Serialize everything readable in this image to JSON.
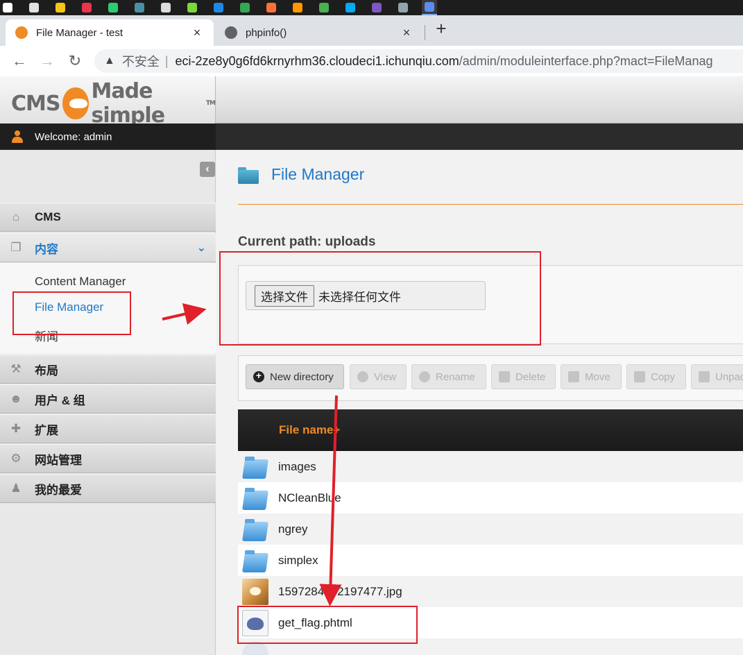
{
  "taskbar": {
    "icons": [
      {
        "name": "windows-start-icon",
        "color": "#ffffff"
      },
      {
        "name": "task-view-icon",
        "color": "#e0e0e0"
      },
      {
        "name": "file-explorer-icon",
        "color": "#f5c518"
      },
      {
        "name": "app-icon-red",
        "color": "#e8344e"
      },
      {
        "name": "app-icon-green",
        "color": "#2ecc71"
      },
      {
        "name": "terminal-icon",
        "color": "#4a90a4"
      },
      {
        "name": "typora-icon",
        "color": "#dddddd"
      },
      {
        "name": "app-icon-lime",
        "color": "#7bd73a"
      },
      {
        "name": "app-icon-p-blue",
        "color": "#1e88e5"
      },
      {
        "name": "chrome-icon",
        "color": "#34a853"
      },
      {
        "name": "firefox-icon",
        "color": "#ff7139"
      },
      {
        "name": "sublime-icon",
        "color": "#ff9800"
      },
      {
        "name": "app-icon-multicolor",
        "color": "#4caf50"
      },
      {
        "name": "app-icon-orange-blue",
        "color": "#03a9f4"
      },
      {
        "name": "app-icon-purple",
        "color": "#7e57c2"
      },
      {
        "name": "app-icon-grey",
        "color": "#90a4ae"
      },
      {
        "name": "chrome-active-icon",
        "color": "#5b8def"
      }
    ]
  },
  "browser": {
    "tabs": [
      {
        "title": "File Manager - test",
        "favicon_color": "#f08a24"
      },
      {
        "title": "phpinfo()",
        "favicon_color": "#5f6368"
      }
    ],
    "close_glyph": "×",
    "new_tab_glyph": "+",
    "back_glyph": "←",
    "forward_glyph": "→",
    "reload_glyph": "↻",
    "warning_glyph": "▲",
    "security_label": "不安全",
    "url_host": "eci-2ze8y0g6fd6krnyrhm36.cloudeci1.ichunqiu.com",
    "url_path": "/admin/moduleinterface.php?mact=FileManag"
  },
  "cms": {
    "logo_left": "CMS",
    "logo_right": "Made simple",
    "logo_tm": "TM",
    "welcome": "Welcome: admin"
  },
  "sidebar": {
    "collapse_glyph": "‹",
    "items": [
      {
        "label": "CMS",
        "icon": "home-icon",
        "glyph": "⌂"
      },
      {
        "label": "内容",
        "icon": "content-icon",
        "glyph": "❐",
        "open": true,
        "chevron": "⌄"
      },
      {
        "label": "布局",
        "icon": "layout-icon",
        "glyph": "⚒"
      },
      {
        "label": "用户 & 组",
        "icon": "users-icon",
        "glyph": "☻"
      },
      {
        "label": "扩展",
        "icon": "extensions-icon",
        "glyph": "✚"
      },
      {
        "label": "网站管理",
        "icon": "site-admin-icon",
        "glyph": "⚙"
      },
      {
        "label": "我的最爱",
        "icon": "favorites-icon",
        "glyph": "♟"
      }
    ],
    "submenu": [
      "Content Manager",
      "File Manager",
      "新闻"
    ]
  },
  "main": {
    "title": "File Manager",
    "current_path": "Current path: uploads",
    "choose_file_button": "选择文件",
    "no_file_text": "未选择任何文件",
    "toolbar": [
      {
        "label": "New directory",
        "enabled": true
      },
      {
        "label": "View",
        "enabled": false
      },
      {
        "label": "Rename",
        "enabled": false
      },
      {
        "label": "Delete",
        "enabled": false
      },
      {
        "label": "Move",
        "enabled": false
      },
      {
        "label": "Copy",
        "enabled": false
      },
      {
        "label": "Unpac",
        "enabled": false
      }
    ],
    "table_header": "File name+",
    "files": [
      {
        "name": "images",
        "type": "folder"
      },
      {
        "name": "NCleanBlue",
        "type": "folder"
      },
      {
        "name": "ngrey",
        "type": "folder"
      },
      {
        "name": "simplex",
        "type": "folder"
      },
      {
        "name": "1597284272197477.jpg",
        "type": "image"
      },
      {
        "name": "get_flag.phtml",
        "type": "php"
      },
      {
        "name": "",
        "type": "partial"
      }
    ]
  },
  "annotation_color": "#e0202a"
}
